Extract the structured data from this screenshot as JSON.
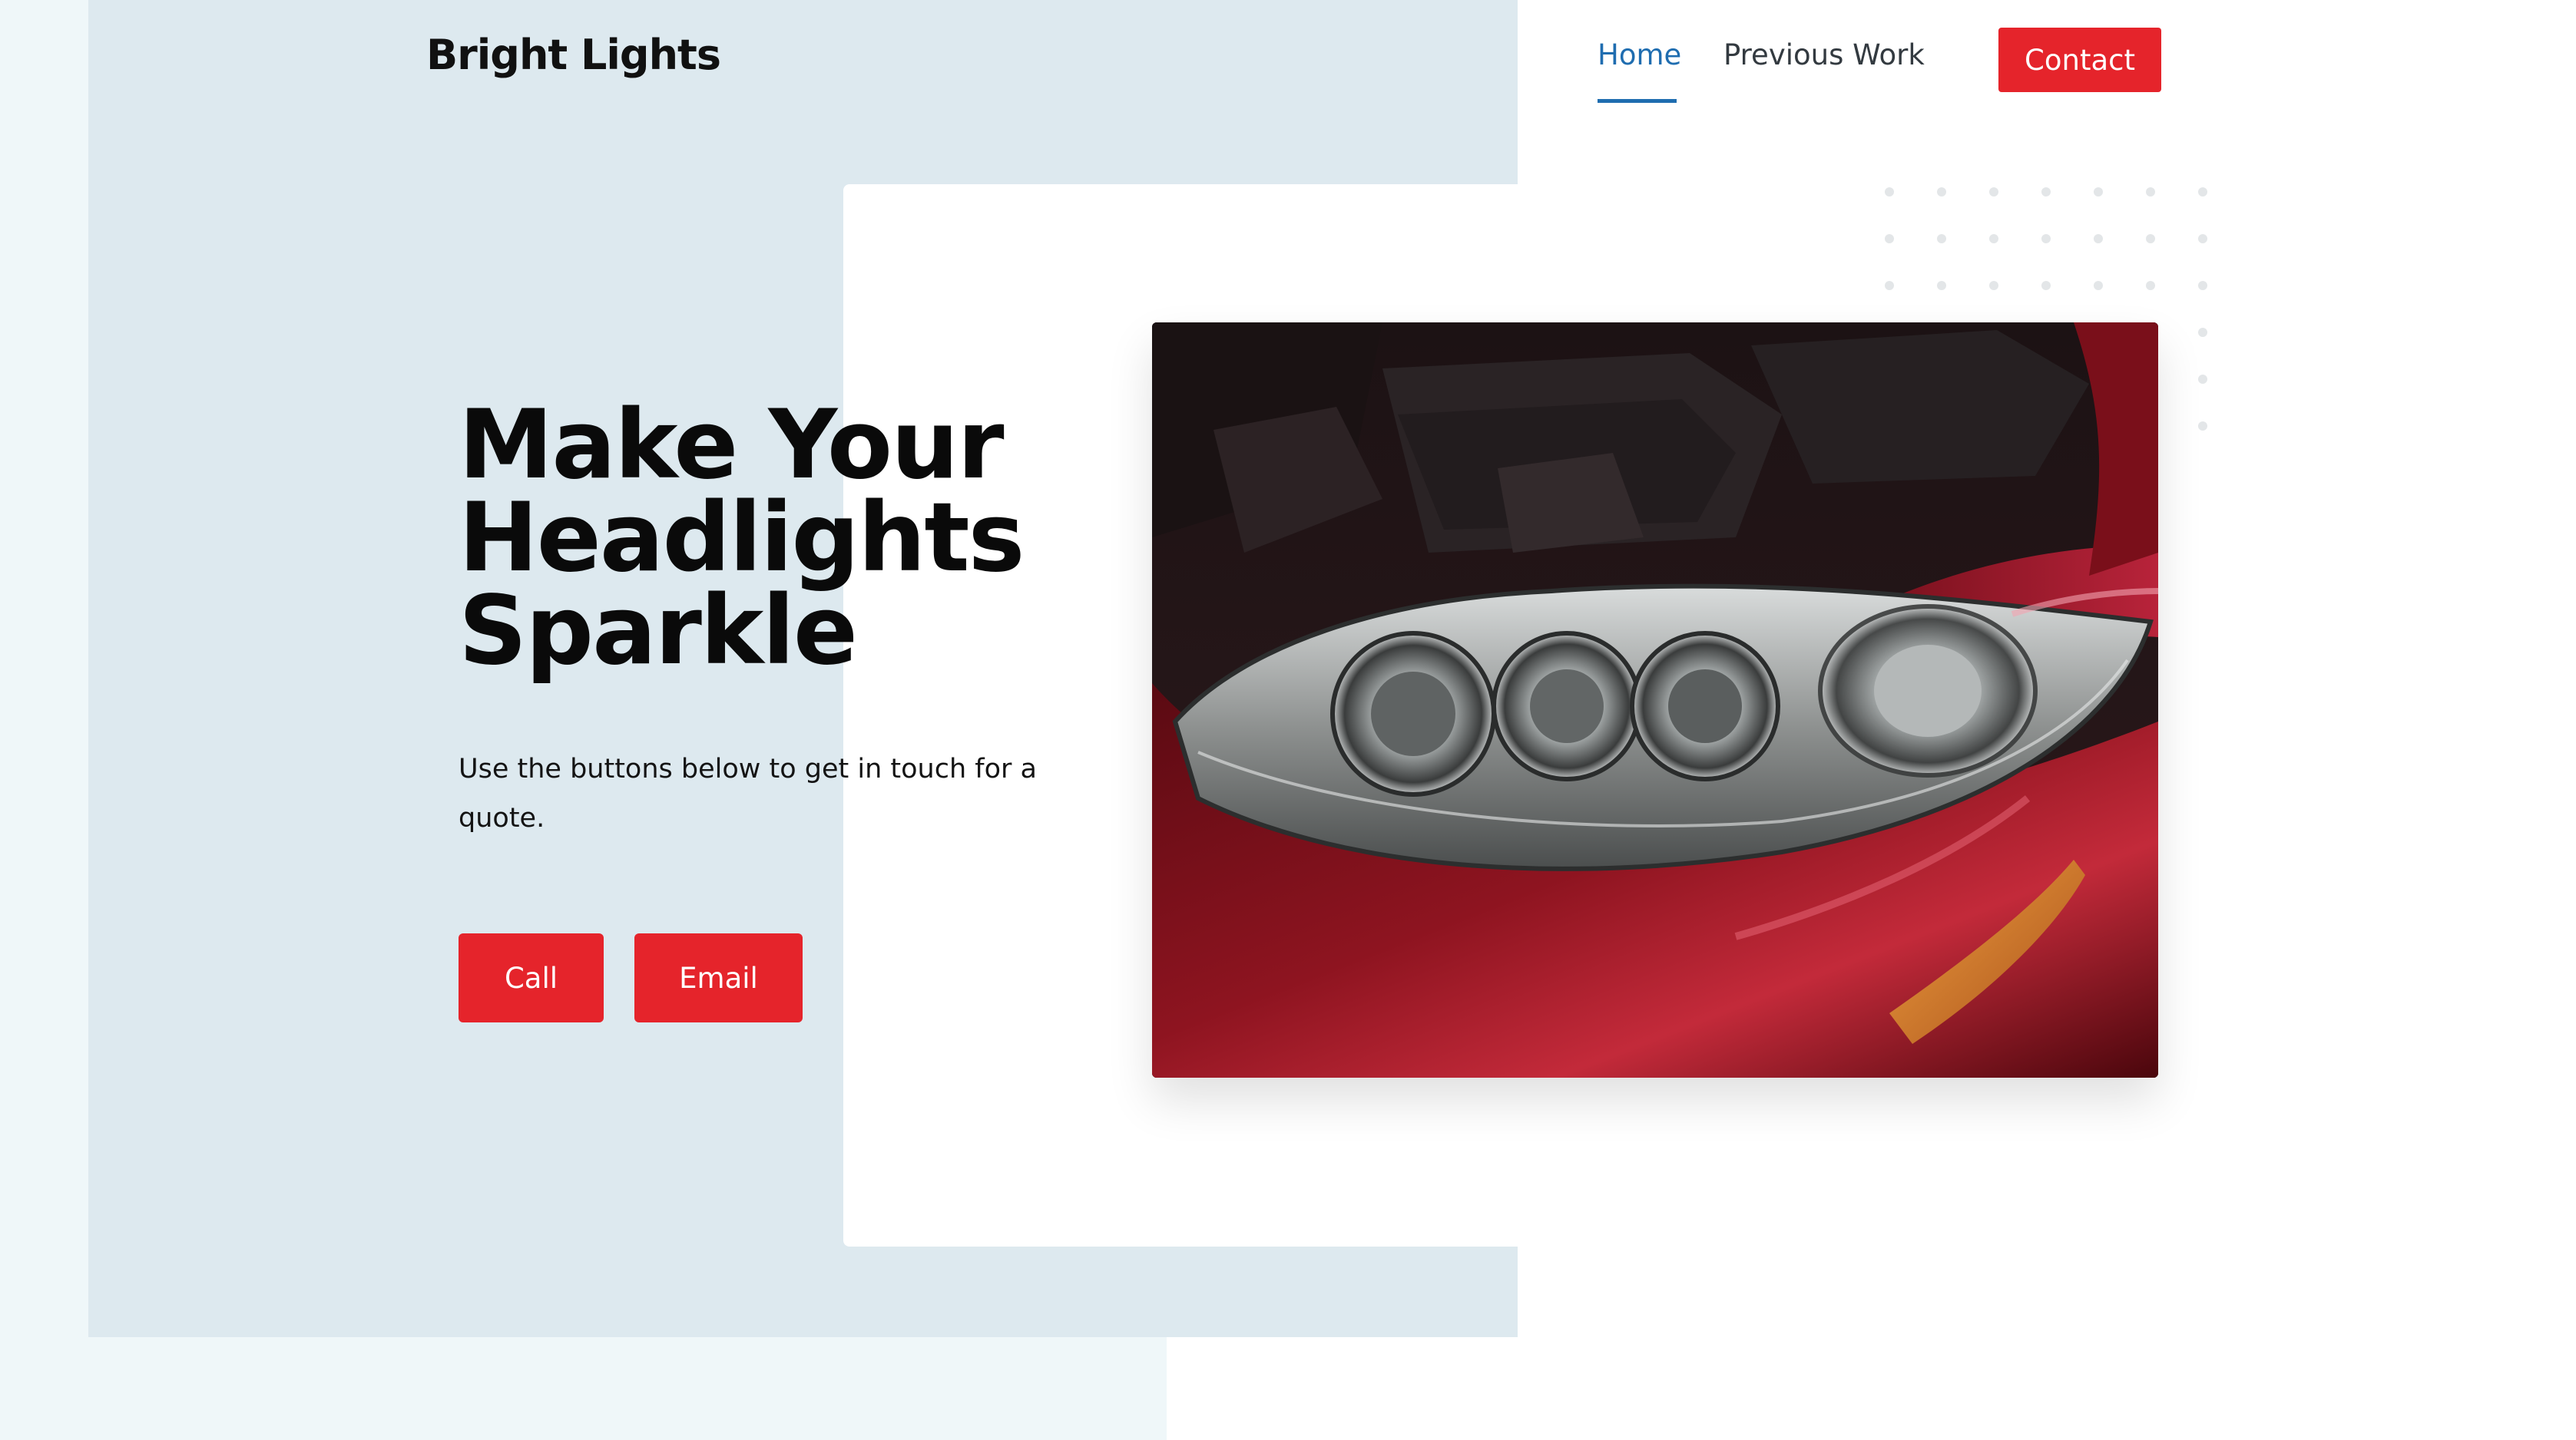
{
  "brand": {
    "name": "Bright Lights"
  },
  "nav": {
    "items": [
      {
        "label": "Home",
        "active": true
      },
      {
        "label": "Previous Work",
        "active": false
      }
    ],
    "contact_label": "Contact"
  },
  "hero": {
    "headline": [
      "Make Your",
      "Headlights",
      "Sparkle"
    ],
    "subtext": "Use the buttons below to get in touch for a quote.",
    "call_label": "Call",
    "email_label": "Email"
  },
  "colors": {
    "accent_red": "#e5242b",
    "nav_active_blue": "#1f6db0",
    "panel_blue": "#dde9ef",
    "panel_light": "#eff7f9"
  },
  "images": {
    "hero_photo": "red-car-headlight-photo"
  }
}
